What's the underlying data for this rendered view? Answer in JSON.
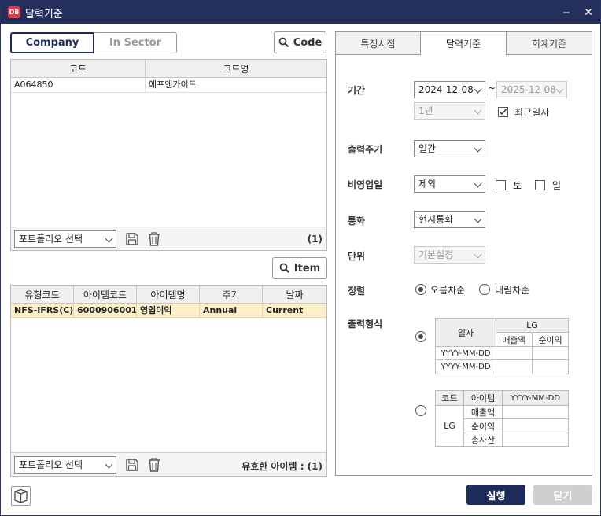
{
  "window": {
    "title": "달력기준",
    "app_icon_text": "DB",
    "minimize": "‒",
    "close": "✕"
  },
  "left": {
    "segment": {
      "company": "Company",
      "in_sector": "In Sector"
    },
    "code_button": "Code",
    "company_grid": {
      "headers": [
        "코드",
        "코드명"
      ],
      "rows": [
        [
          "A064850",
          "에프앤가이드"
        ]
      ]
    },
    "portfolio_select_1": "포트폴리오 선택",
    "company_count": "(1)",
    "item_button": "Item",
    "item_grid": {
      "headers": [
        "유형코드",
        "아이템코드",
        "아이템명",
        "주기",
        "날짜"
      ],
      "rows": [
        [
          "NFS-IFRS(C)",
          "6000906001",
          "영업이익",
          "Annual",
          "Current"
        ]
      ]
    },
    "portfolio_select_2": "포트폴리오 선택",
    "item_count": "유효한 아이템 : (1)"
  },
  "right": {
    "tabs": [
      "특정시점",
      "달력기준",
      "회계기준"
    ],
    "active_tab": "달력기준",
    "period": {
      "label": "기간",
      "start": "2024-12-08",
      "separator": "~",
      "end": "2025-12-08",
      "range": "1년",
      "recent_label": "최근일자",
      "recent_checked": true
    },
    "cycle": {
      "label": "출력주기",
      "value": "일간"
    },
    "nonbusiness": {
      "label": "비영업일",
      "value": "제외",
      "sat": "토",
      "sun": "일"
    },
    "currency": {
      "label": "통화",
      "value": "현지통화"
    },
    "unit": {
      "label": "단위",
      "value": "기본설정"
    },
    "sort": {
      "label": "정렬",
      "asc": "오름차순",
      "desc": "내림차순"
    },
    "format": {
      "label": "출력형식",
      "t1": {
        "date_header": "일자",
        "company": "LG",
        "col1": "매출액",
        "col2": "순이익",
        "row1": "YYYY-MM-DD",
        "row2": "YYYY-MM-DD"
      },
      "t2": {
        "h_code": "코드",
        "h_item": "아이템",
        "h_date": "YYYY-MM-DD",
        "company": "LG",
        "items": [
          "매출액",
          "순이익",
          "총자산"
        ]
      }
    }
  },
  "footer": {
    "run": "실행",
    "close": "닫기"
  },
  "colors": {
    "titlebar": "#252f5c",
    "accent": "#1e2a5a",
    "selected_row": "#fdf0c8",
    "disabled_button": "#cfcfcf"
  }
}
